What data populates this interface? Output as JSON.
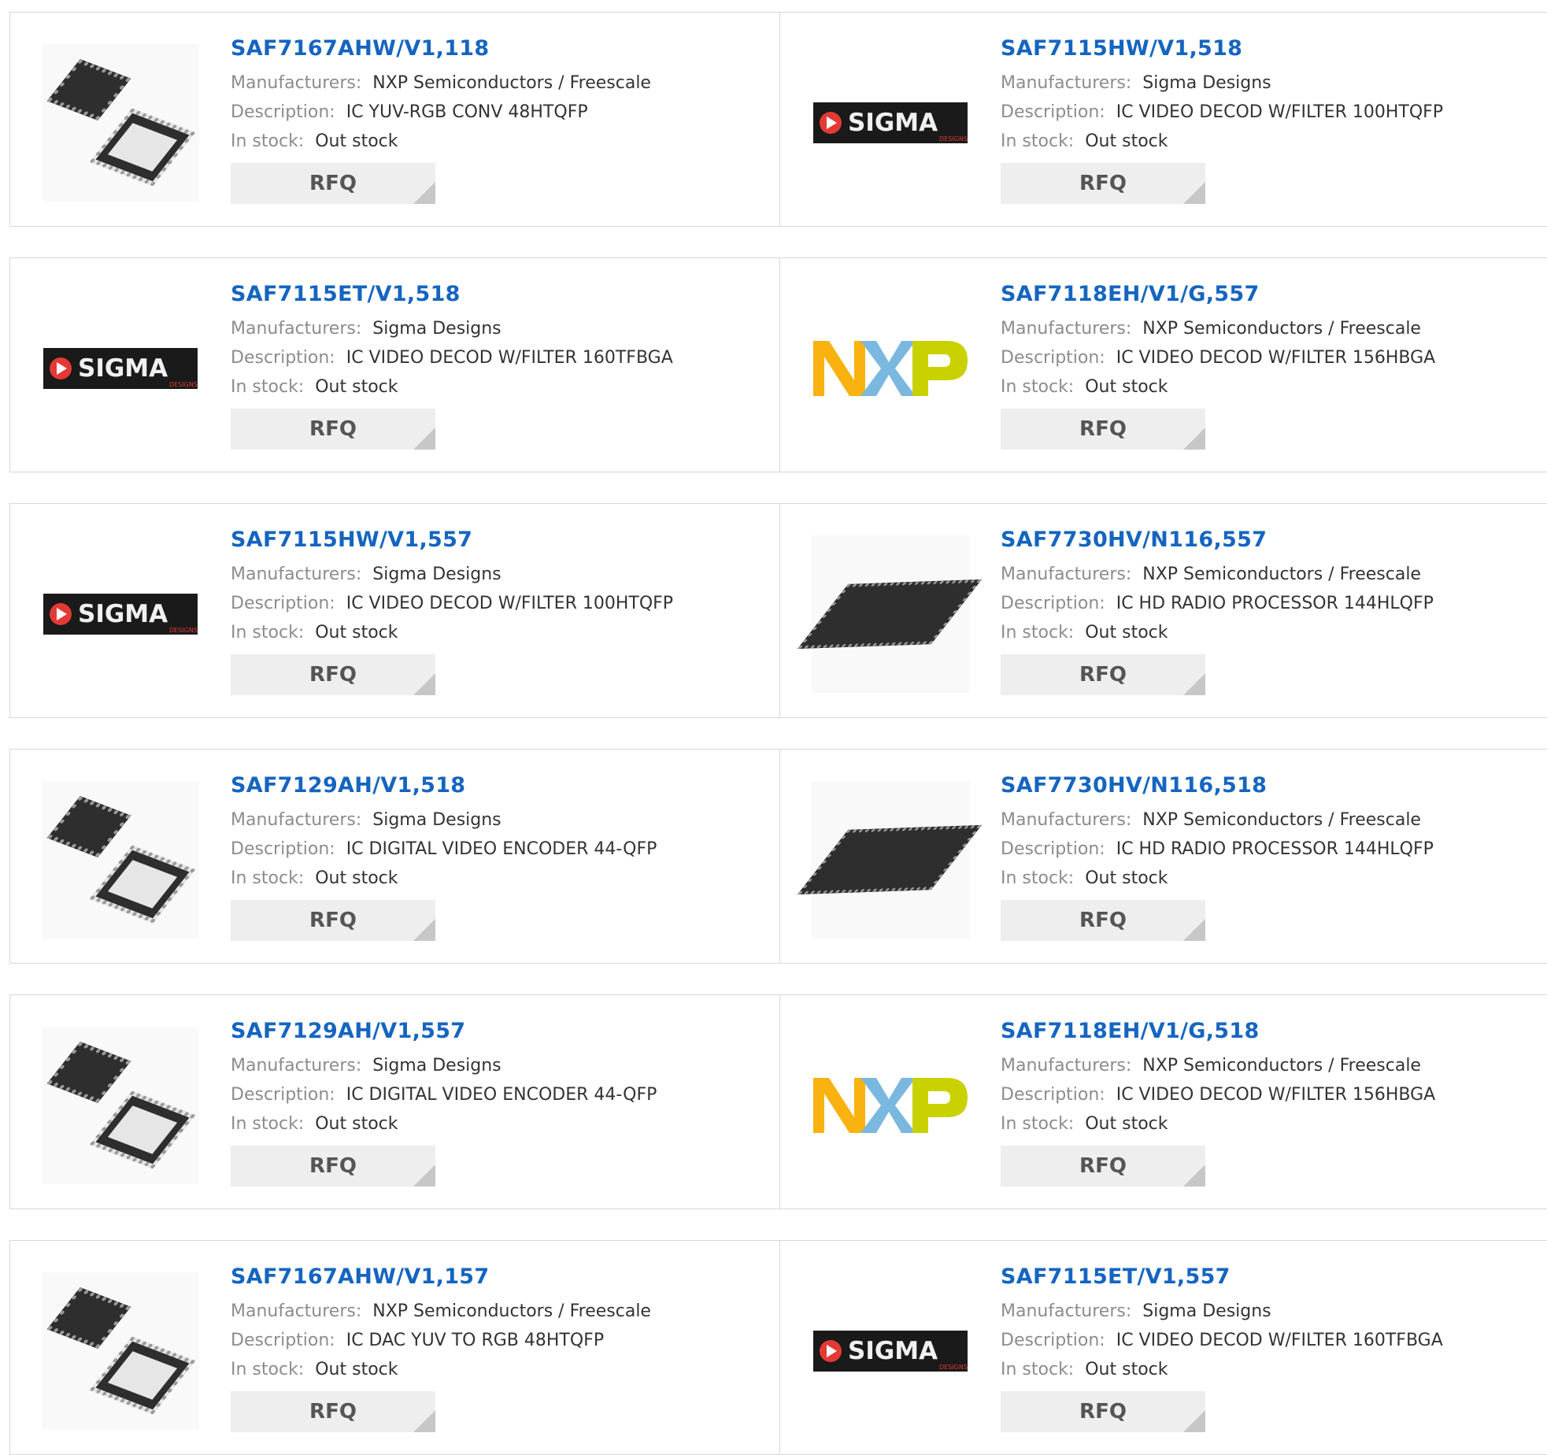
{
  "labels": {
    "manufacturers": "Manufacturers:",
    "description": "Description:",
    "stock": "In stock:",
    "rfq": "RFQ"
  },
  "products": [
    {
      "part": "SAF7167AHW/V1,118",
      "manufacturer": "NXP Semiconductors / Freescale",
      "description": "IC YUV-RGB CONV 48HTQFP",
      "stock": "Out stock",
      "image": "qfp-chip-pair"
    },
    {
      "part": "SAF7115HW/V1,518",
      "manufacturer": "Sigma Designs",
      "description": "IC VIDEO DECOD W/FILTER 100HTQFP",
      "stock": "Out stock",
      "image": "sigma-designs-logo"
    },
    {
      "part": "SAF7115ET/V1,518",
      "manufacturer": "Sigma Designs",
      "description": "IC VIDEO DECOD W/FILTER 160TFBGA",
      "stock": "Out stock",
      "image": "sigma-designs-logo"
    },
    {
      "part": "SAF7118EH/V1/G,557",
      "manufacturer": "NXP Semiconductors / Freescale",
      "description": "IC VIDEO DECOD W/FILTER 156HBGA",
      "stock": "Out stock",
      "image": "nxp-logo"
    },
    {
      "part": "SAF7115HW/V1,557",
      "manufacturer": "Sigma Designs",
      "description": "IC VIDEO DECOD W/FILTER 100HTQFP",
      "stock": "Out stock",
      "image": "sigma-designs-logo"
    },
    {
      "part": "SAF7730HV/N116,557",
      "manufacturer": "NXP Semiconductors / Freescale",
      "description": "IC HD RADIO PROCESSOR 144HLQFP",
      "stock": "Out stock",
      "image": "lqfp-chip"
    },
    {
      "part": "SAF7129AH/V1,518",
      "manufacturer": "Sigma Designs",
      "description": "IC DIGITAL VIDEO ENCODER 44-QFP",
      "stock": "Out stock",
      "image": "qfp-chip-pair"
    },
    {
      "part": "SAF7730HV/N116,518",
      "manufacturer": "NXP Semiconductors / Freescale",
      "description": "IC HD RADIO PROCESSOR 144HLQFP",
      "stock": "Out stock",
      "image": "lqfp-chip"
    },
    {
      "part": "SAF7129AH/V1,557",
      "manufacturer": "Sigma Designs",
      "description": "IC DIGITAL VIDEO ENCODER 44-QFP",
      "stock": "Out stock",
      "image": "qfp-chip-pair"
    },
    {
      "part": "SAF7118EH/V1/G,518",
      "manufacturer": "NXP Semiconductors / Freescale",
      "description": "IC VIDEO DECOD W/FILTER 156HBGA",
      "stock": "Out stock",
      "image": "nxp-logo"
    },
    {
      "part": "SAF7167AHW/V1,157",
      "manufacturer": "NXP Semiconductors / Freescale",
      "description": "IC DAC YUV TO RGB 48HTQFP",
      "stock": "Out stock",
      "image": "qfp-chip-pair"
    },
    {
      "part": "SAF7115ET/V1,557",
      "manufacturer": "Sigma Designs",
      "description": "IC VIDEO DECOD W/FILTER 160TFBGA",
      "stock": "Out stock",
      "image": "sigma-designs-logo"
    }
  ],
  "logos": {
    "sigma_text": "SIGMA",
    "sigma_sub": "DESIGNS",
    "sigma_colors": {
      "bg": "#1a1a1a",
      "accent": "#e53935",
      "text": "#f0f0f0"
    },
    "nxp_colors": {
      "n": "#f9b20f",
      "x": "#7bb8e0",
      "p": "#c9d200"
    }
  }
}
